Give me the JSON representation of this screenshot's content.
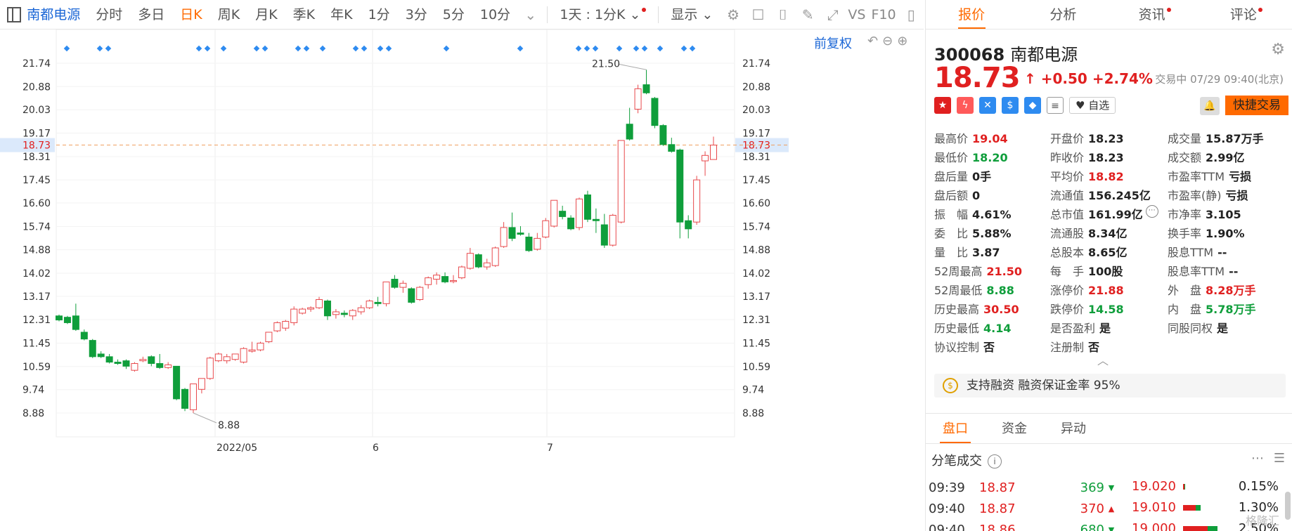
{
  "toolbar": {
    "stock_name": "南都电源",
    "tabs": [
      "分时",
      "多日",
      "日K",
      "周K",
      "月K",
      "季K",
      "年K",
      "1分",
      "3分",
      "5分",
      "10分"
    ],
    "active_tab": "日K",
    "day_select": "1天 : 1分K",
    "display": "显示",
    "vs": "VS",
    "f10": "F10"
  },
  "chart": {
    "fq_label": "前复权",
    "y_labels": [
      "21.74",
      "20.88",
      "20.03",
      "19.17",
      "18.73",
      "18.31",
      "17.45",
      "16.60",
      "15.74",
      "14.88",
      "14.02",
      "13.17",
      "12.31",
      "11.45",
      "10.59",
      "9.74",
      "8.88"
    ],
    "current_price": "18.73",
    "x_labels": [
      "2022/05",
      "6",
      "7"
    ],
    "high_label": "21.50",
    "low_label": "8.88"
  },
  "chart_data": {
    "type": "candlestick",
    "ylim": [
      8.4,
      22.2
    ],
    "current": 18.73,
    "candles": [
      [
        12.45,
        12.5,
        12.3,
        12.25
      ],
      [
        12.4,
        12.45,
        12.2,
        12.15
      ],
      [
        12.45,
        12.9,
        11.95,
        11.9
      ],
      [
        11.85,
        11.95,
        11.6,
        11.55
      ],
      [
        11.55,
        11.6,
        10.95,
        10.9
      ],
      [
        11.05,
        11.15,
        10.95,
        10.9
      ],
      [
        10.95,
        11.05,
        10.75,
        10.7
      ],
      [
        10.75,
        10.85,
        10.7,
        10.65
      ],
      [
        10.8,
        10.85,
        10.6,
        10.5
      ],
      [
        10.45,
        10.75,
        10.7,
        10.4
      ],
      [
        10.8,
        10.95,
        10.85,
        10.75
      ],
      [
        10.95,
        11.0,
        10.7,
        10.6
      ],
      [
        10.7,
        11.05,
        10.55,
        10.5
      ],
      [
        10.55,
        10.75,
        10.65,
        10.5
      ],
      [
        10.6,
        10.6,
        9.4,
        9.35
      ],
      [
        9.75,
        9.8,
        9.05,
        8.95
      ],
      [
        9.0,
        9.95,
        9.95,
        8.88
      ],
      [
        9.75,
        10.15,
        10.15,
        9.6
      ],
      [
        10.15,
        10.95,
        10.9,
        10.1
      ],
      [
        10.8,
        11.1,
        11.05,
        10.75
      ],
      [
        10.8,
        11.05,
        10.95,
        10.7
      ],
      [
        10.85,
        11.05,
        11.05,
        10.8
      ],
      [
        10.75,
        11.3,
        11.25,
        10.7
      ],
      [
        11.15,
        11.5,
        11.2,
        11.1
      ],
      [
        11.2,
        11.5,
        11.45,
        11.15
      ],
      [
        11.5,
        11.85,
        11.85,
        11.45
      ],
      [
        11.9,
        12.25,
        12.2,
        11.85
      ],
      [
        12.0,
        12.3,
        12.25,
        11.9
      ],
      [
        12.2,
        12.8,
        12.7,
        12.1
      ],
      [
        12.55,
        12.75,
        12.7,
        12.5
      ],
      [
        12.7,
        12.8,
        12.75,
        12.6
      ],
      [
        12.75,
        13.15,
        13.05,
        12.7
      ],
      [
        13.0,
        13.05,
        12.45,
        12.3
      ],
      [
        12.5,
        12.7,
        12.6,
        12.35
      ],
      [
        12.55,
        12.65,
        12.5,
        12.4
      ],
      [
        12.45,
        12.7,
        12.65,
        12.3
      ],
      [
        12.6,
        12.85,
        12.75,
        12.5
      ],
      [
        12.75,
        13.05,
        13.0,
        12.7
      ],
      [
        12.95,
        13.15,
        12.9,
        12.8
      ],
      [
        12.9,
        13.7,
        13.7,
        12.8
      ],
      [
        13.8,
        13.95,
        13.5,
        13.45
      ],
      [
        13.5,
        13.75,
        13.65,
        13.3
      ],
      [
        13.45,
        13.5,
        12.95,
        12.9
      ],
      [
        13.05,
        13.55,
        13.5,
        13.0
      ],
      [
        13.6,
        13.9,
        13.85,
        13.45
      ],
      [
        13.8,
        14.05,
        13.95,
        13.6
      ],
      [
        13.9,
        14.05,
        13.7,
        13.65
      ],
      [
        13.75,
        13.95,
        13.75,
        13.65
      ],
      [
        13.85,
        14.3,
        14.25,
        13.8
      ],
      [
        14.2,
        14.95,
        14.75,
        14.15
      ],
      [
        14.7,
        14.75,
        14.25,
        14.2
      ],
      [
        14.25,
        14.55,
        14.4,
        14.15
      ],
      [
        14.3,
        15.0,
        14.95,
        14.25
      ],
      [
        15.0,
        15.9,
        15.7,
        14.95
      ],
      [
        15.7,
        16.25,
        15.3,
        15.2
      ],
      [
        15.5,
        15.75,
        15.45,
        15.4
      ],
      [
        15.35,
        15.5,
        14.85,
        14.8
      ],
      [
        14.9,
        15.5,
        15.3,
        14.85
      ],
      [
        15.35,
        16.05,
        15.95,
        15.3
      ],
      [
        15.75,
        16.7,
        16.7,
        15.7
      ],
      [
        16.3,
        16.5,
        16.1,
        16.0
      ],
      [
        16.05,
        16.15,
        15.65,
        15.6
      ],
      [
        15.7,
        16.8,
        16.75,
        15.6
      ],
      [
        16.9,
        17.05,
        16.0,
        15.9
      ],
      [
        16.0,
        16.4,
        15.95,
        15.5
      ],
      [
        15.8,
        16.2,
        15.05,
        14.95
      ],
      [
        15.05,
        16.2,
        16.15,
        15.0
      ],
      [
        15.9,
        18.9,
        18.9,
        15.85
      ],
      [
        19.5,
        20.1,
        18.95,
        18.9
      ],
      [
        20.05,
        20.95,
        20.8,
        19.9
      ],
      [
        20.95,
        21.5,
        20.65,
        20.6
      ],
      [
        20.45,
        20.5,
        19.45,
        19.35
      ],
      [
        19.45,
        19.5,
        18.75,
        18.7
      ],
      [
        18.75,
        19.0,
        18.5,
        18.45
      ],
      [
        18.55,
        18.6,
        15.9,
        15.3
      ],
      [
        15.95,
        16.15,
        15.65,
        15.3
      ],
      [
        15.9,
        17.6,
        17.45,
        15.8
      ],
      [
        18.15,
        18.5,
        18.35,
        17.6
      ],
      [
        18.2,
        19.04,
        18.73,
        18.2
      ]
    ],
    "markers": [
      95,
      142,
      154,
      283,
      295,
      318,
      365,
      377,
      424,
      436,
      459,
      506,
      518,
      541,
      553,
      635,
      740,
      823,
      835,
      847,
      881,
      905,
      917,
      939,
      973,
      985
    ]
  },
  "right": {
    "tabs": [
      "报价",
      "分析",
      "资讯",
      "评论"
    ],
    "active_tab": "报价",
    "code": "300068",
    "name": "南都电源",
    "price": "18.73",
    "arrow": "↑",
    "change": "+0.50",
    "pct": "+2.74%",
    "status": "交易中 07/29 09:40(北京)",
    "zixuan": "自选",
    "quick_trade": "快捷交易",
    "fields": [
      [
        [
          "最高价",
          "19.04",
          "up"
        ],
        [
          "开盘价",
          "18.23",
          ""
        ],
        [
          "成交量",
          "15.87万手",
          ""
        ]
      ],
      [
        [
          "最低价",
          "18.20",
          "dn"
        ],
        [
          "昨收价",
          "18.23",
          ""
        ],
        [
          "成交额",
          "2.99亿",
          ""
        ]
      ],
      [
        [
          "盘后量",
          "0手",
          ""
        ],
        [
          "平均价",
          "18.82",
          "up"
        ],
        [
          "市盈率TTM",
          "亏损",
          ""
        ]
      ],
      [
        [
          "盘后额",
          "0",
          ""
        ],
        [
          "流通值",
          "156.245亿",
          ""
        ],
        [
          "市盈率(静)",
          "亏损",
          ""
        ]
      ],
      [
        [
          "振　幅",
          "4.61%",
          ""
        ],
        [
          "总市值",
          "161.99亿",
          ""
        ],
        [
          "市净率",
          "3.105",
          ""
        ]
      ],
      [
        [
          "委　比",
          "5.88%",
          ""
        ],
        [
          "流通股",
          "8.34亿",
          ""
        ],
        [
          "换手率",
          "1.90%",
          ""
        ]
      ],
      [
        [
          "量　比",
          "3.87",
          ""
        ],
        [
          "总股本",
          "8.65亿",
          ""
        ],
        [
          "股息TTM",
          "--",
          ""
        ]
      ],
      [
        [
          "52周最高",
          "21.50",
          "up"
        ],
        [
          "每　手",
          "100股",
          ""
        ],
        [
          "股息率TTM",
          "--",
          ""
        ]
      ],
      [
        [
          "52周最低",
          "8.88",
          "dn"
        ],
        [
          "涨停价",
          "21.88",
          "up"
        ],
        [
          "外　盘",
          "8.28万手",
          "up"
        ]
      ],
      [
        [
          "历史最高",
          "30.50",
          "up"
        ],
        [
          "跌停价",
          "14.58",
          "dn"
        ],
        [
          "内　盘",
          "5.78万手",
          "dn"
        ]
      ],
      [
        [
          "历史最低",
          "4.14",
          "dn"
        ],
        [
          "是否盈利",
          "是",
          ""
        ],
        [
          "同股同权",
          "是",
          ""
        ]
      ],
      [
        [
          "协议控制",
          "否",
          ""
        ],
        [
          "注册制",
          "否",
          ""
        ],
        [
          "",
          "",
          ""
        ]
      ]
    ],
    "margin": "支持融资 融资保证金率 95%",
    "sub_tabs": [
      "盘口",
      "资金",
      "异动"
    ],
    "sub_active": "盘口",
    "tick_title": "分笔成交",
    "ticks": [
      [
        "09:39",
        "18.87",
        "369",
        "dn"
      ],
      [
        "09:40",
        "18.87",
        "370",
        "up"
      ],
      [
        "09:40",
        "18.86",
        "680",
        "dn"
      ]
    ],
    "depth": [
      [
        "19.020",
        "0.15%",
        0.04
      ],
      [
        "19.010",
        "1.30%",
        0.35
      ],
      [
        "19.000",
        "2.50%",
        0.7
      ]
    ],
    "watermark": "格隆汇"
  }
}
